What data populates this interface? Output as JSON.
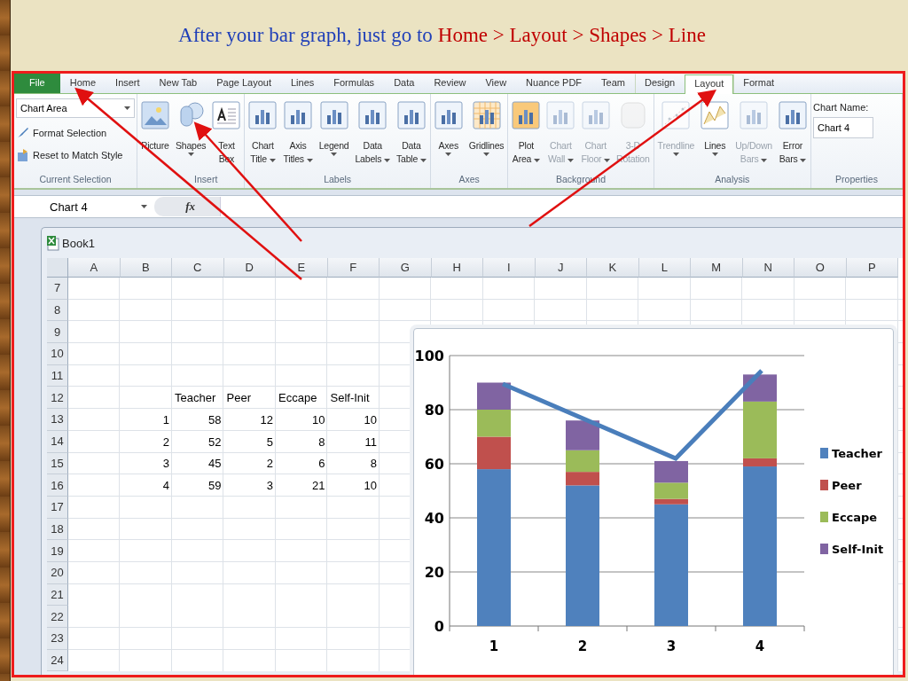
{
  "slide_title": {
    "lead": "After your bar graph, just go to",
    "path": "Home > Layout > Shapes > Line"
  },
  "tabs": [
    {
      "label": "File",
      "kind": "file",
      "selected": false
    },
    {
      "label": "Home",
      "kind": "tab",
      "selected": false
    },
    {
      "label": "Insert",
      "kind": "tab",
      "selected": false
    },
    {
      "label": "New Tab",
      "kind": "tab",
      "selected": false
    },
    {
      "label": "Page Layout",
      "kind": "tab",
      "selected": false
    },
    {
      "label": "Lines",
      "kind": "tab",
      "selected": false
    },
    {
      "label": "Formulas",
      "kind": "tab",
      "selected": false
    },
    {
      "label": "Data",
      "kind": "tab",
      "selected": false
    },
    {
      "label": "Review",
      "kind": "tab",
      "selected": false
    },
    {
      "label": "View",
      "kind": "tab",
      "selected": false
    },
    {
      "label": "Nuance PDF",
      "kind": "tab",
      "selected": false
    },
    {
      "label": "Team",
      "kind": "tab",
      "selected": false
    },
    {
      "label": "Design",
      "kind": "context",
      "selected": false
    },
    {
      "label": "Layout",
      "kind": "context",
      "selected": true
    },
    {
      "label": "Format",
      "kind": "context",
      "selected": false
    }
  ],
  "ribbon": {
    "current_selection": {
      "label": "Current Selection",
      "dropdown": "Chart Area",
      "items": [
        {
          "label": "Format Selection",
          "kind": "format"
        },
        {
          "label": "Reset to Match Style",
          "kind": "reset"
        }
      ]
    },
    "groups": [
      {
        "label": "Insert",
        "buttons": [
          {
            "lines": [
              "Picture"
            ],
            "kind": "picture",
            "dropdown": false,
            "disabled": false
          },
          {
            "lines": [
              "Shapes"
            ],
            "kind": "shapes",
            "dropdown": true,
            "disabled": false
          },
          {
            "lines": [
              "Text",
              "Box"
            ],
            "kind": "textbox",
            "dropdown": false,
            "disabled": false
          }
        ]
      },
      {
        "label": "Labels",
        "buttons": [
          {
            "lines": [
              "Chart",
              "Title"
            ],
            "kind": "chart",
            "dropdown": true,
            "disabled": false
          },
          {
            "lines": [
              "Axis",
              "Titles"
            ],
            "kind": "chart",
            "dropdown": true,
            "disabled": false
          },
          {
            "lines": [
              "Legend"
            ],
            "kind": "chart",
            "dropdown": true,
            "disabled": false
          },
          {
            "lines": [
              "Data",
              "Labels"
            ],
            "kind": "chart",
            "dropdown": true,
            "disabled": false
          },
          {
            "lines": [
              "Data",
              "Table"
            ],
            "kind": "chart",
            "dropdown": true,
            "disabled": false
          }
        ]
      },
      {
        "label": "Axes",
        "buttons": [
          {
            "lines": [
              "Axes"
            ],
            "kind": "chart",
            "dropdown": true,
            "disabled": false
          },
          {
            "lines": [
              "Gridlines"
            ],
            "kind": "grid",
            "dropdown": true,
            "disabled": false
          }
        ]
      },
      {
        "label": "Background",
        "buttons": [
          {
            "lines": [
              "Plot",
              "Area"
            ],
            "kind": "plot",
            "dropdown": true,
            "disabled": false
          },
          {
            "lines": [
              "Chart",
              "Wall"
            ],
            "kind": "chart",
            "dropdown": true,
            "disabled": true
          },
          {
            "lines": [
              "Chart",
              "Floor"
            ],
            "kind": "chart",
            "dropdown": true,
            "disabled": true
          },
          {
            "lines": [
              "3-D",
              "Rotation"
            ],
            "kind": "rotation",
            "dropdown": false,
            "disabled": true
          }
        ]
      },
      {
        "label": "Analysis",
        "buttons": [
          {
            "lines": [
              "Trendline"
            ],
            "kind": "trend",
            "dropdown": true,
            "disabled": true
          },
          {
            "lines": [
              "Lines"
            ],
            "kind": "lines",
            "dropdown": true,
            "disabled": false
          },
          {
            "lines": [
              "Up/Down",
              "Bars"
            ],
            "kind": "chart",
            "dropdown": true,
            "disabled": true
          },
          {
            "lines": [
              "Error",
              "Bars"
            ],
            "kind": "chart",
            "dropdown": true,
            "disabled": false
          }
        ]
      }
    ],
    "properties": {
      "label": "Properties",
      "name_label": "Chart Name:",
      "name_value": "Chart 4"
    }
  },
  "formula_bar": {
    "name_box": "Chart 4",
    "fx": "fx"
  },
  "workbook": {
    "title": "Book1",
    "columns": [
      "A",
      "B",
      "C",
      "D",
      "E",
      "F",
      "G",
      "H",
      "I",
      "J",
      "K",
      "L",
      "M",
      "N",
      "O",
      "P"
    ],
    "rows": [
      {
        "header": "7"
      },
      {
        "header": "8"
      },
      {
        "header": "9"
      },
      {
        "header": "10"
      },
      {
        "header": "11"
      },
      {
        "header": "12",
        "cells": [
          null,
          null,
          "Teacher",
          "Peer",
          "Eccape",
          "Self-Init"
        ]
      },
      {
        "header": "13",
        "cells": [
          null,
          "1",
          "58",
          "12",
          "10",
          "10"
        ]
      },
      {
        "header": "14",
        "cells": [
          null,
          "2",
          "52",
          "5",
          "8",
          "11"
        ]
      },
      {
        "header": "15",
        "cells": [
          null,
          "3",
          "45",
          "2",
          "6",
          "8"
        ]
      },
      {
        "header": "16",
        "cells": [
          null,
          "4",
          "59",
          "3",
          "21",
          "10"
        ]
      },
      {
        "header": "17"
      },
      {
        "header": "18"
      },
      {
        "header": "19"
      },
      {
        "header": "20"
      },
      {
        "header": "21"
      },
      {
        "header": "22"
      },
      {
        "header": "23"
      },
      {
        "header": "24"
      }
    ]
  },
  "chart": {
    "chart_data": {
      "type": "bar",
      "stacked": true,
      "grid": true,
      "legend": true,
      "categories": [
        "1",
        "2",
        "3",
        "4"
      ],
      "series": [
        {
          "name": "Teacher",
          "color": "#4f81bd",
          "values": [
            58,
            52,
            45,
            59
          ]
        },
        {
          "name": "Peer",
          "color": "#c0504d",
          "values": [
            12,
            5,
            2,
            3
          ]
        },
        {
          "name": "Eccape",
          "color": "#9bbb59",
          "values": [
            10,
            8,
            6,
            21
          ]
        },
        {
          "name": "Self-Init",
          "color": "#8064a2",
          "values": [
            10,
            11,
            8,
            10
          ]
        }
      ],
      "ylim": [
        0,
        100
      ],
      "yticks": [
        0,
        20,
        40,
        60,
        80,
        100
      ]
    }
  }
}
